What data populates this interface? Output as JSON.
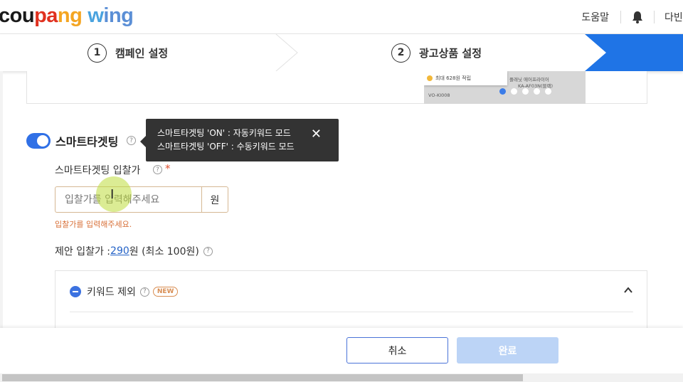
{
  "header": {
    "logo_parts": [
      {
        "text": "cou",
        "color": "#1a1a1a"
      },
      {
        "text": "pa",
        "color": "#e0311f"
      },
      {
        "text": "ng",
        "color": "#f4a521"
      },
      {
        "text": " ",
        "color": "#1a1a1a"
      },
      {
        "text": "w",
        "color": "#4aa3df"
      },
      {
        "text": "ing",
        "color": "#5b8fd6"
      }
    ],
    "help_label": "도움말",
    "user_name": "다빈"
  },
  "steps": {
    "step1": {
      "num": "1",
      "label": "캠페인 설정"
    },
    "step2": {
      "num": "2",
      "label": "광고상품 설정"
    },
    "active_color": "#1f74e6"
  },
  "preview": {
    "badge_text": "최대 628원 적립",
    "product_a": "VO-KI008",
    "product_b": "플래닛 에어프라이어",
    "product_b_model": "KA-AF03N(블랙)"
  },
  "smart_targeting": {
    "label": "스마트타겟팅",
    "enabled": true,
    "tooltip_line1": "스마트타겟팅 'ON' : 자동키워드 모드",
    "tooltip_line2": "스마트타겟팅 'OFF' : 수동키워드 모드",
    "close_symbol": "✕"
  },
  "bid": {
    "label": "스마트타겟팅 입찰가",
    "required_mark": "*",
    "placeholder": "입찰가를 입력해주세요",
    "unit": "원",
    "error": "입찰가를 입력해주세요.",
    "suggest_prefix": "제안 입찰가 : ",
    "suggest_value": "290",
    "suggest_suffix": "원 (최소 100원)"
  },
  "keyword_exclude": {
    "label": "키워드 제외",
    "badge": "NEW"
  },
  "footer": {
    "cancel_label": "취소",
    "done_label": "완료"
  },
  "colors": {
    "primary": "#3070e6",
    "error": "#d87038",
    "tooltip_bg": "#333333"
  }
}
